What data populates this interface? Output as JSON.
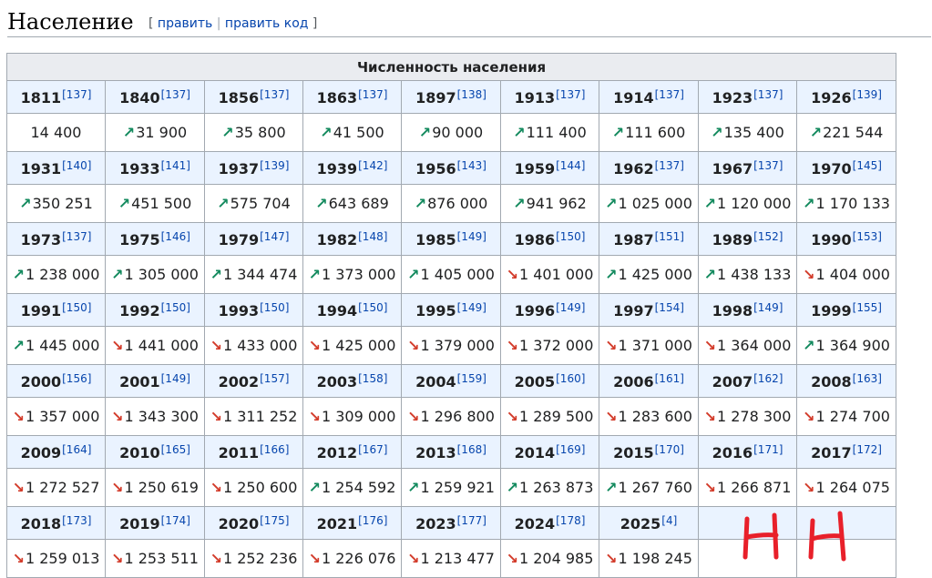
{
  "section": {
    "title": "Население",
    "edit_open": "[",
    "edit_label": "править",
    "edit_sep": "|",
    "edit_code_label": "править код",
    "edit_close": "]"
  },
  "table": {
    "caption": "Численность населения",
    "arrow_up": "↗",
    "arrow_down": "↘",
    "rows": [
      [
        {
          "year": "1811",
          "ref": "[137]",
          "value": "14 400",
          "trend": ""
        },
        {
          "year": "1840",
          "ref": "[137]",
          "value": "31 900",
          "trend": "up"
        },
        {
          "year": "1856",
          "ref": "[137]",
          "value": "35 800",
          "trend": "up"
        },
        {
          "year": "1863",
          "ref": "[137]",
          "value": "41 500",
          "trend": "up"
        },
        {
          "year": "1897",
          "ref": "[138]",
          "value": "90 000",
          "trend": "up"
        },
        {
          "year": "1913",
          "ref": "[137]",
          "value": "111 400",
          "trend": "up"
        },
        {
          "year": "1914",
          "ref": "[137]",
          "value": "111 600",
          "trend": "up"
        },
        {
          "year": "1923",
          "ref": "[137]",
          "value": "135 400",
          "trend": "up"
        },
        {
          "year": "1926",
          "ref": "[139]",
          "value": "221 544",
          "trend": "up"
        }
      ],
      [
        {
          "year": "1931",
          "ref": "[140]",
          "value": "350 251",
          "trend": "up"
        },
        {
          "year": "1933",
          "ref": "[141]",
          "value": "451 500",
          "trend": "up"
        },
        {
          "year": "1937",
          "ref": "[139]",
          "value": "575 704",
          "trend": "up"
        },
        {
          "year": "1939",
          "ref": "[142]",
          "value": "643 689",
          "trend": "up"
        },
        {
          "year": "1956",
          "ref": "[143]",
          "value": "876 000",
          "trend": "up"
        },
        {
          "year": "1959",
          "ref": "[144]",
          "value": "941 962",
          "trend": "up"
        },
        {
          "year": "1962",
          "ref": "[137]",
          "value": "1 025 000",
          "trend": "up"
        },
        {
          "year": "1967",
          "ref": "[137]",
          "value": "1 120 000",
          "trend": "up"
        },
        {
          "year": "1970",
          "ref": "[145]",
          "value": "1 170 133",
          "trend": "up"
        }
      ],
      [
        {
          "year": "1973",
          "ref": "[137]",
          "value": "1 238 000",
          "trend": "up"
        },
        {
          "year": "1975",
          "ref": "[146]",
          "value": "1 305 000",
          "trend": "up"
        },
        {
          "year": "1979",
          "ref": "[147]",
          "value": "1 344 474",
          "trend": "up"
        },
        {
          "year": "1982",
          "ref": "[148]",
          "value": "1 373 000",
          "trend": "up"
        },
        {
          "year": "1985",
          "ref": "[149]",
          "value": "1 405 000",
          "trend": "up"
        },
        {
          "year": "1986",
          "ref": "[150]",
          "value": "1 401 000",
          "trend": "down"
        },
        {
          "year": "1987",
          "ref": "[151]",
          "value": "1 425 000",
          "trend": "up"
        },
        {
          "year": "1989",
          "ref": "[152]",
          "value": "1 438 133",
          "trend": "up"
        },
        {
          "year": "1990",
          "ref": "[153]",
          "value": "1 404 000",
          "trend": "down"
        }
      ],
      [
        {
          "year": "1991",
          "ref": "[150]",
          "value": "1 445 000",
          "trend": "up"
        },
        {
          "year": "1992",
          "ref": "[150]",
          "value": "1 441 000",
          "trend": "down"
        },
        {
          "year": "1993",
          "ref": "[150]",
          "value": "1 433 000",
          "trend": "down"
        },
        {
          "year": "1994",
          "ref": "[150]",
          "value": "1 425 000",
          "trend": "down"
        },
        {
          "year": "1995",
          "ref": "[149]",
          "value": "1 379 000",
          "trend": "down"
        },
        {
          "year": "1996",
          "ref": "[149]",
          "value": "1 372 000",
          "trend": "down"
        },
        {
          "year": "1997",
          "ref": "[154]",
          "value": "1 371 000",
          "trend": "down"
        },
        {
          "year": "1998",
          "ref": "[149]",
          "value": "1 364 000",
          "trend": "down"
        },
        {
          "year": "1999",
          "ref": "[155]",
          "value": "1 364 900",
          "trend": "up"
        }
      ],
      [
        {
          "year": "2000",
          "ref": "[156]",
          "value": "1 357 000",
          "trend": "down"
        },
        {
          "year": "2001",
          "ref": "[149]",
          "value": "1 343 300",
          "trend": "down"
        },
        {
          "year": "2002",
          "ref": "[157]",
          "value": "1 311 252",
          "trend": "down"
        },
        {
          "year": "2003",
          "ref": "[158]",
          "value": "1 309 000",
          "trend": "down"
        },
        {
          "year": "2004",
          "ref": "[159]",
          "value": "1 296 800",
          "trend": "down"
        },
        {
          "year": "2005",
          "ref": "[160]",
          "value": "1 289 500",
          "trend": "down"
        },
        {
          "year": "2006",
          "ref": "[161]",
          "value": "1 283 600",
          "trend": "down"
        },
        {
          "year": "2007",
          "ref": "[162]",
          "value": "1 278 300",
          "trend": "down"
        },
        {
          "year": "2008",
          "ref": "[163]",
          "value": "1 274 700",
          "trend": "down"
        }
      ],
      [
        {
          "year": "2009",
          "ref": "[164]",
          "value": "1 272 527",
          "trend": "down"
        },
        {
          "year": "2010",
          "ref": "[165]",
          "value": "1 250 619",
          "trend": "down"
        },
        {
          "year": "2011",
          "ref": "[166]",
          "value": "1 250 600",
          "trend": "down"
        },
        {
          "year": "2012",
          "ref": "[167]",
          "value": "1 254 592",
          "trend": "up"
        },
        {
          "year": "2013",
          "ref": "[168]",
          "value": "1 259 921",
          "trend": "up"
        },
        {
          "year": "2014",
          "ref": "[169]",
          "value": "1 263 873",
          "trend": "up"
        },
        {
          "year": "2015",
          "ref": "[170]",
          "value": "1 267 760",
          "trend": "up"
        },
        {
          "year": "2016",
          "ref": "[171]",
          "value": "1 266 871",
          "trend": "down"
        },
        {
          "year": "2017",
          "ref": "[172]",
          "value": "1 264 075",
          "trend": "down"
        }
      ],
      [
        {
          "year": "2018",
          "ref": "[173]",
          "value": "1 259 013",
          "trend": "down"
        },
        {
          "year": "2019",
          "ref": "[174]",
          "value": "1 253 511",
          "trend": "down"
        },
        {
          "year": "2020",
          "ref": "[175]",
          "value": "1 252 236",
          "trend": "down"
        },
        {
          "year": "2021",
          "ref": "[176]",
          "value": "1 226 076",
          "trend": "down"
        },
        {
          "year": "2023",
          "ref": "[177]",
          "value": "1 213 477",
          "trend": "down"
        },
        {
          "year": "2024",
          "ref": "[178]",
          "value": "1 204 985",
          "trend": "down"
        },
        {
          "year": "2025",
          "ref": "[4]",
          "value": "1 198 245",
          "trend": "down"
        },
        {
          "year": "",
          "ref": "",
          "value": "",
          "trend": ""
        },
        {
          "year": "",
          "ref": "",
          "value": "",
          "trend": ""
        }
      ]
    ]
  },
  "colors": {
    "up": "#138a5e",
    "down": "#d33c2b",
    "link": "#0645ad",
    "year_bg": "#eaf3ff",
    "caption_bg": "#eaecf0",
    "handwriting": "#e8202a"
  }
}
